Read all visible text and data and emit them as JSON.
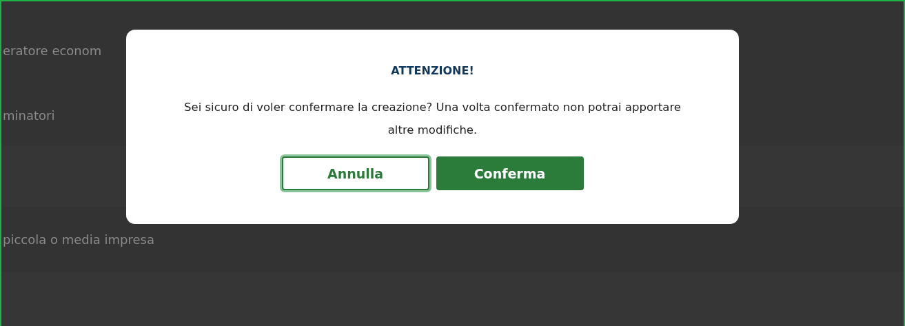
{
  "background_rows": [
    {
      "label": "eratore econom"
    },
    {
      "label": "minatori"
    },
    {
      "label": ""
    },
    {
      "label": "piccola o media impresa"
    },
    {
      "label": ""
    }
  ],
  "dialog": {
    "title": "ATTENZIONE!",
    "message": "Sei sicuro di voler confermare la creazione? Una volta confermato non potrai apportare altre modifiche.",
    "buttons": [
      {
        "label": "Annulla",
        "kind": "secondary",
        "focused": true
      },
      {
        "label": "Conferma",
        "kind": "primary",
        "focused": false
      }
    ]
  }
}
